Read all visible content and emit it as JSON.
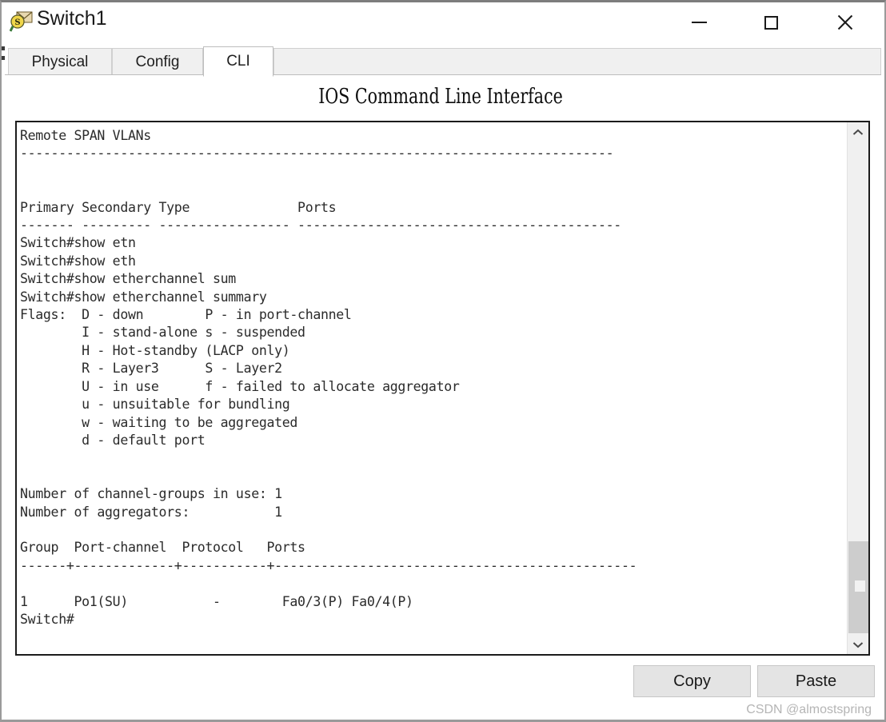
{
  "window": {
    "title": "Switch1",
    "icon": "packet-tracer-inspect-icon",
    "controls": {
      "minimize": "minimize-icon",
      "maximize": "maximize-icon",
      "close": "close-icon"
    }
  },
  "tabs": [
    {
      "label": "Physical",
      "active": false
    },
    {
      "label": "Config",
      "active": false
    },
    {
      "label": "CLI",
      "active": true
    }
  ],
  "panel": {
    "heading": "IOS Command Line Interface"
  },
  "terminal": {
    "lines": [
      "Remote SPAN VLANs",
      "-----------------------------------------------------------------------------",
      "",
      "",
      "Primary Secondary Type              Ports",
      "------- --------- ----------------- ------------------------------------------",
      "Switch#show etn",
      "Switch#show eth",
      "Switch#show etherchannel sum",
      "Switch#show etherchannel summary",
      "Flags:  D - down        P - in port-channel",
      "        I - stand-alone s - suspended",
      "        H - Hot-standby (LACP only)",
      "        R - Layer3      S - Layer2",
      "        U - in use      f - failed to allocate aggregator",
      "        u - unsuitable for bundling",
      "        w - waiting to be aggregated",
      "        d - default port",
      "",
      "",
      "Number of channel-groups in use: 1",
      "Number of aggregators:           1",
      "",
      "Group  Port-channel  Protocol   Ports",
      "------+-------------+-----------+-----------------------------------------------",
      "",
      "1      Po1(SU)           -        Fa0/3(P) Fa0/4(P)",
      "Switch#"
    ]
  },
  "scrollbar": {
    "up_arrow": "chevron-up-icon",
    "down_arrow": "chevron-down-icon"
  },
  "buttons": {
    "copy": "Copy",
    "paste": "Paste"
  },
  "watermark": "CSDN @almostspring",
  "colors": {
    "window_border": "#9a9a9a",
    "tab_inactive_bg": "#f0f0f0",
    "tab_active_bg": "#ffffff",
    "terminal_border": "#1c1c1c",
    "terminal_text": "#2b2b2b",
    "button_bg": "#e4e4e4",
    "scrollbar_thumb": "#cdcdcd",
    "watermark": "#b5b5b5"
  }
}
